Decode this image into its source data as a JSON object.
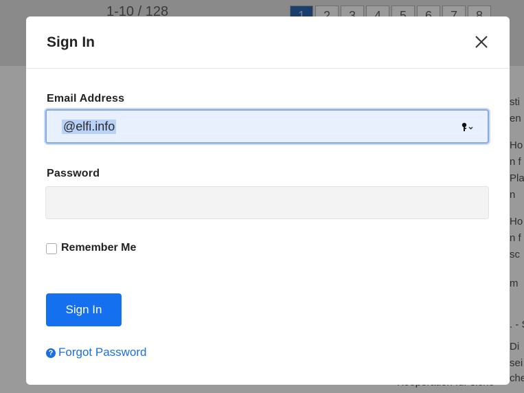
{
  "background": {
    "page_count_text": "1-10 / 128",
    "pager": [
      "1",
      "2",
      "3",
      "4",
      "5",
      "6",
      "7",
      "8"
    ],
    "active_page": "1",
    "right_snippets": [
      "sti",
      "en",
      "Ho",
      "n f",
      "Pla",
      "n",
      "Ho",
      "n f",
      "sc",
      "m",
      ". - S",
      "Di",
      "sei",
      "che"
    ],
    "bottom_text": "Kooperation für siche"
  },
  "modal": {
    "title": "Sign In",
    "email_label": "Email Address",
    "email_value": "@elfi.info",
    "password_label": "Password",
    "password_value": "",
    "remember_label": "Remember Me",
    "remember_checked": false,
    "submit_label": "Sign In",
    "forgot_label": "Forgot Password"
  },
  "icons": {
    "close": "close-icon",
    "key": "key-icon",
    "help": "question-circle-icon"
  },
  "colors": {
    "primary": "#1570ef",
    "link": "#1b6fe0",
    "overlay": "#7d7d7d"
  }
}
